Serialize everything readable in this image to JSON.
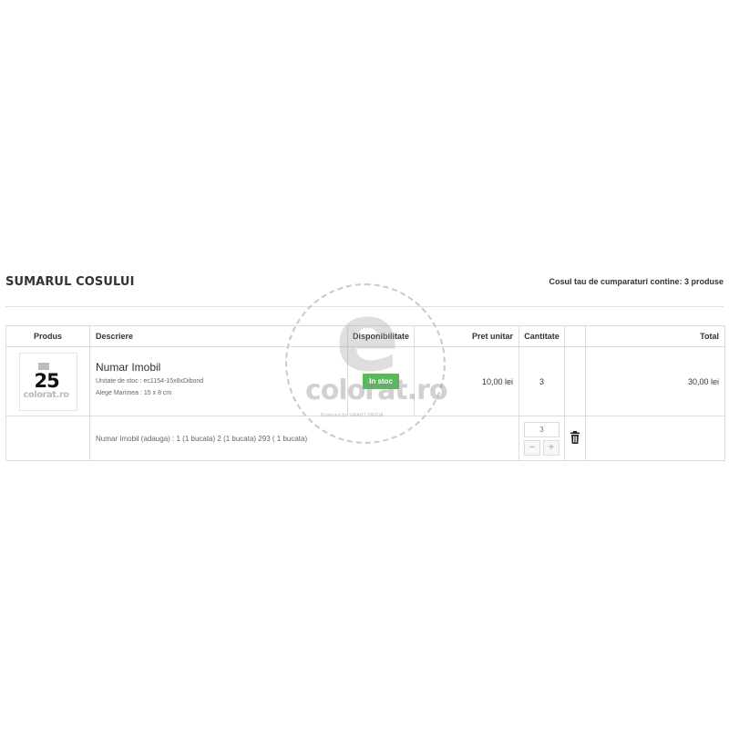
{
  "page": {
    "title": "SUMARUL COSULUI",
    "cart_summary": "Cosul tau de cumparaturi contine: 3 produse"
  },
  "table": {
    "headers": {
      "product": "Produs",
      "description": "Descriere",
      "availability": "Disponibilitate",
      "unit_price": "Pret unitar",
      "quantity": "Cantitate",
      "actions": "",
      "total": "Total"
    },
    "item": {
      "thumb_number": "25",
      "thumb_brand": "colorat.ro",
      "name": "Numar Imobil",
      "sku": "Unitate de stoc : ec1154-15x8xDibond",
      "size": "Alege Marimea : 15 x 8 cm",
      "stock_label": "In stoc",
      "stock_color": "#5cb85c",
      "unit_price": "10,00 lei",
      "quantity": "3",
      "total": "30,00 lei"
    },
    "customization": {
      "text": "Numar Imobil (adauga) : 1 (1 bucata) 2 (1 bucata) 293 ( 1 bucata)",
      "quantity_value": "3",
      "minus_label": "−",
      "plus_label": "+",
      "delete_icon": "trash-icon"
    }
  },
  "watermark": {
    "letter": "e",
    "brand": "colorat.ro",
    "powered": "Powered by SMART MEDIA"
  }
}
